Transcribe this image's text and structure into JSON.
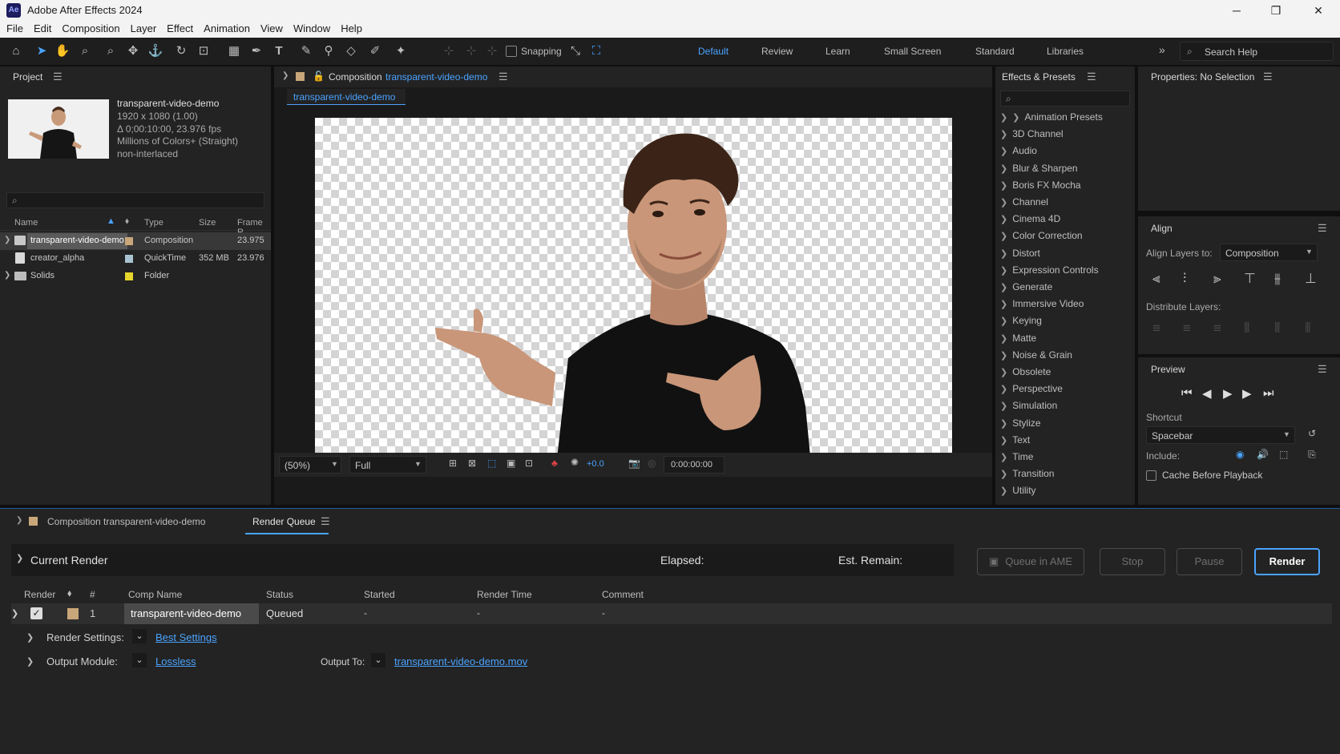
{
  "window": {
    "logo": "Ae",
    "title": "Adobe After Effects 2024",
    "controls": [
      "─",
      "❐",
      "✕"
    ]
  },
  "menu": [
    "File",
    "Edit",
    "Composition",
    "Layer",
    "Effect",
    "Animation",
    "View",
    "Window",
    "Help"
  ],
  "toolbar": {
    "snapping": "Snapping",
    "workspaces": [
      "Default",
      "Review",
      "Learn",
      "Small Screen",
      "Standard",
      "Libraries"
    ],
    "active_workspace": "Default",
    "more": "»",
    "search_help": "Search Help"
  },
  "project": {
    "title": "Project",
    "item_name": "transparent-video-demo",
    "item_info": [
      "1920 x 1080 (1.00)",
      "Δ 0;00:10:00, 23.976 fps",
      "Millions of Colors+ (Straight)",
      "non-interlaced"
    ],
    "columns": {
      "name": "Name",
      "type": "Type",
      "size": "Size",
      "frame": "Frame R."
    },
    "rows": [
      {
        "name": "transparent-video-demo",
        "type": "Composition",
        "size": "",
        "frame": "23.975",
        "color": "#c9a77a",
        "kind": "comp"
      },
      {
        "name": "creator_alpha",
        "type": "QuickTime",
        "size": "352 MB",
        "frame": "23.976",
        "color": "#a9c4d0",
        "kind": "file"
      },
      {
        "name": "Solids",
        "type": "Folder",
        "size": "",
        "frame": "",
        "color": "#e6d52a",
        "kind": "folder"
      }
    ]
  },
  "comp": {
    "label": "Composition",
    "name": "transparent-video-demo",
    "tab": "transparent-video-demo",
    "zoom": "(50%)",
    "resolution": "Full",
    "exposure": "+0.0",
    "timecode": "0:00:00:00"
  },
  "effects": {
    "title": "Effects & Presets",
    "items": [
      "Animation Presets",
      "3D Channel",
      "Audio",
      "Blur & Sharpen",
      "Boris FX Mocha",
      "Channel",
      "Cinema 4D",
      "Color Correction",
      "Distort",
      "Expression Controls",
      "Generate",
      "Immersive Video",
      "Keying",
      "Matte",
      "Noise & Grain",
      "Obsolete",
      "Perspective",
      "Simulation",
      "Stylize",
      "Text",
      "Time",
      "Transition",
      "Utility"
    ]
  },
  "properties": {
    "title": "Properties: No Selection"
  },
  "align": {
    "title": "Align",
    "align_to_label": "Align Layers to:",
    "align_to_value": "Composition",
    "distribute_label": "Distribute Layers:"
  },
  "preview": {
    "title": "Preview",
    "shortcut_label": "Shortcut",
    "shortcut_value": "Spacebar",
    "include_label": "Include:",
    "cache_label": "Cache Before Playback"
  },
  "render": {
    "tab_comp": "Composition transparent-video-demo",
    "tab_rq": "Render Queue",
    "current_render": "Current Render",
    "elapsed": "Elapsed:",
    "est_remain": "Est. Remain:",
    "queue_ame": "Queue in AME",
    "stop": "Stop",
    "pause": "Pause",
    "render": "Render",
    "columns": [
      "Render",
      "#",
      "Comp Name",
      "Status",
      "Started",
      "Render Time",
      "Comment"
    ],
    "row": {
      "num": "1",
      "comp": "transparent-video-demo",
      "status": "Queued",
      "started": "-",
      "render_time": "-",
      "comment": "-"
    },
    "render_settings_label": "Render Settings:",
    "render_settings_value": "Best Settings",
    "output_module_label": "Output Module:",
    "output_module_value": "Lossless",
    "output_to_label": "Output To:",
    "output_to_value": "transparent-video-demo.mov"
  },
  "colors": {
    "accent": "#4aa3ff",
    "panel": "#232323",
    "bg": "#0f0f0f"
  }
}
